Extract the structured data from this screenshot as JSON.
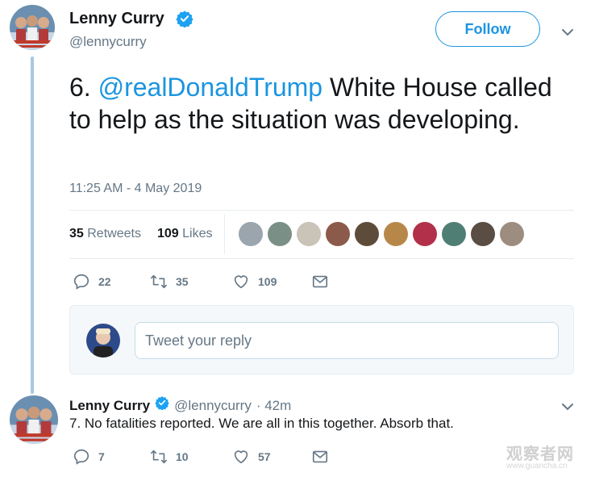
{
  "tweet": {
    "author_name": "Lenny Curry",
    "author_handle": "@lennycurry",
    "follow_label": "Follow",
    "text_prefix": "6. ",
    "mention": "@realDonaldTrump",
    "text_rest": " White House called to help as the situation was developing.",
    "timestamp": "11:25 AM - 4 May 2019",
    "retweets_count": "35",
    "retweets_label": "Retweets",
    "likes_count": "109",
    "likes_label": "Likes",
    "liker_avatar_colors": [
      "#9aa5ae",
      "#7a8f86",
      "#c9c3b8",
      "#8c5a4a",
      "#5e4c3a",
      "#b7874a",
      "#b2304a",
      "#4f7f74",
      "#5a4d43",
      "#9c8d80"
    ],
    "actions": {
      "reply_count": "22",
      "retweet_count": "35",
      "like_count": "109"
    }
  },
  "reply_composer": {
    "placeholder": "Tweet your reply"
  },
  "reply_tweet": {
    "author_name": "Lenny Curry",
    "author_handle": "@lennycurry",
    "time": "· 42m",
    "text": "7. No fatalities reported. We are all in this together. Absorb that.",
    "actions": {
      "reply_count": "7",
      "retweet_count": "10",
      "like_count": "57"
    }
  },
  "watermark": {
    "main": "观察者网",
    "sub": "www.guancha.cn"
  },
  "colors": {
    "accent": "#1b95e0",
    "muted": "#657786",
    "thread_line": "#a8c8e0"
  }
}
